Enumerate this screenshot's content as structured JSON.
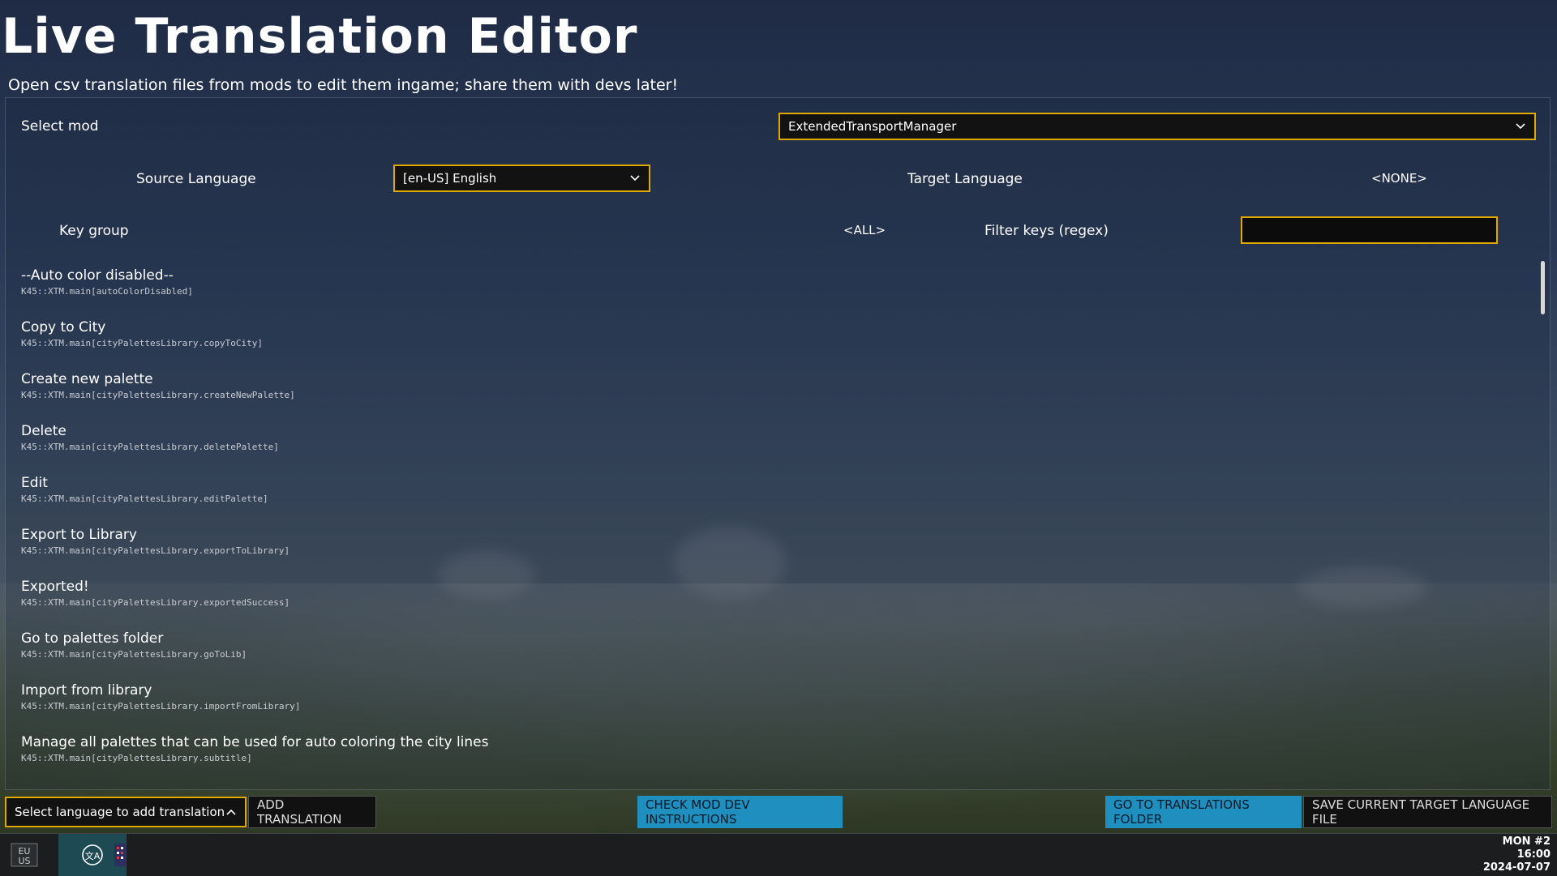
{
  "header": {
    "title": "Live Translation Editor",
    "subtitle": "Open csv translation files from mods to edit them ingame; share them with devs later!"
  },
  "controls": {
    "select_mod_label": "Select mod",
    "select_mod_value": "ExtendedTransportManager",
    "source_language_label": "Source Language",
    "source_language_value": "[en-US] English",
    "target_language_label": "Target Language",
    "target_language_value": "<NONE>",
    "key_group_label": "Key group",
    "key_group_value": "<ALL>",
    "filter_label": "Filter keys (regex)",
    "filter_value": ""
  },
  "entries": [
    {
      "name": "--Auto color disabled--",
      "key": "K45::XTM.main[autoColorDisabled]"
    },
    {
      "name": "Copy to City",
      "key": "K45::XTM.main[cityPalettesLibrary.copyToCity]"
    },
    {
      "name": "Create new palette",
      "key": "K45::XTM.main[cityPalettesLibrary.createNewPalette]"
    },
    {
      "name": "Delete",
      "key": "K45::XTM.main[cityPalettesLibrary.deletePalette]"
    },
    {
      "name": "Edit",
      "key": "K45::XTM.main[cityPalettesLibrary.editPalette]"
    },
    {
      "name": "Export to Library",
      "key": "K45::XTM.main[cityPalettesLibrary.exportToLibrary]"
    },
    {
      "name": "Exported!",
      "key": "K45::XTM.main[cityPalettesLibrary.exportedSuccess]"
    },
    {
      "name": "Go to palettes folder",
      "key": "K45::XTM.main[cityPalettesLibrary.goToLib]"
    },
    {
      "name": "Import from library",
      "key": "K45::XTM.main[cityPalettesLibrary.importFromLibrary]"
    },
    {
      "name": "Manage all palettes that can be used for auto coloring the city lines",
      "key": "K45::XTM.main[cityPalettesLibrary.subtitle]"
    }
  ],
  "footer": {
    "language_select": "Select language to add translation",
    "add_translation": "Add translation",
    "check_instructions": "Check mod dev instructions",
    "go_to_folder": "Go to translations folder",
    "save_file": "Save current target language file"
  },
  "taskbar": {
    "clock_day": "MON #2",
    "clock_time": "16:00",
    "clock_date": "2024-07-07"
  },
  "colors": {
    "accent_border": "#e0a800",
    "button_blue": "#1e8fbf"
  }
}
